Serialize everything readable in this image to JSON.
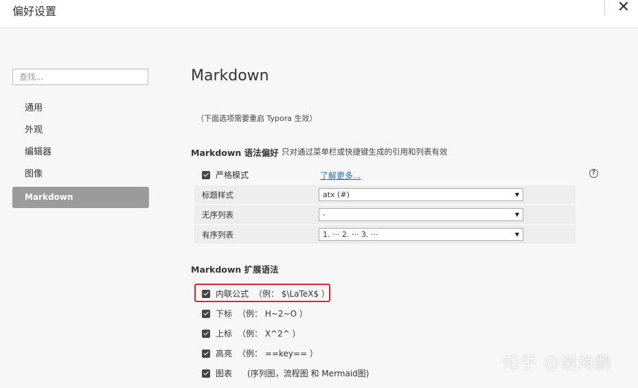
{
  "window": {
    "title": "偏好设置",
    "close_glyph": "✕"
  },
  "sidebar": {
    "search_placeholder": "查找...",
    "items": [
      {
        "label": "通用"
      },
      {
        "label": "外观"
      },
      {
        "label": "编辑器"
      },
      {
        "label": "图像"
      },
      {
        "label": "Markdown",
        "active": true
      }
    ]
  },
  "main": {
    "title": "Markdown",
    "restart_note": "（下面选项需要重启 Typora 生效）",
    "syntax_pref": {
      "title": "Markdown 语法偏好",
      "note": "只对通过菜单栏或快捷键生成的引用和列表有效",
      "strict_mode": {
        "label": "严格模式",
        "checked": true
      },
      "learn_more": "了解更多...",
      "help_icon": "question-circle",
      "heading_style": {
        "label": "标题样式",
        "value": "atx (#)"
      },
      "unordered_list": {
        "label": "无序列表",
        "value": "-"
      },
      "ordered_list": {
        "label": "有序列表",
        "value": "1. ··· 2. ··· 3. ···"
      }
    },
    "extended_syntax": {
      "title": "Markdown 扩展语法",
      "items": [
        {
          "label": "内联公式",
          "example": "（例： $\\LaTeX$ ）",
          "checked": true
        },
        {
          "label": "下标",
          "example": "（例： H~2~O ）",
          "checked": true
        },
        {
          "label": "上标",
          "example": "（例： X^2^ ）",
          "checked": true
        },
        {
          "label": "高亮",
          "example": "（例： ==key== ）",
          "checked": true
        },
        {
          "label": "图表",
          "example": "(序列图，流程图 和 Mermaid图)",
          "checked": true
        }
      ]
    }
  },
  "colors": {
    "highlight_border": "#d9262a",
    "active_nav_bg": "#9b9b9b",
    "link": "#2a6fb5"
  },
  "watermark": "知乎 @谢海鹏"
}
